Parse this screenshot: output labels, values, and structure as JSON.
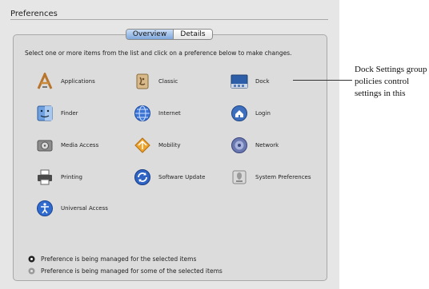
{
  "window": {
    "title": "Preferences"
  },
  "tabs": [
    {
      "label": "Overview",
      "active": true
    },
    {
      "label": "Details",
      "active": false
    }
  ],
  "instructions": "Select one or more items from the list and click on a preference below to make changes.",
  "items": [
    {
      "label": "Applications",
      "icon": "applications-icon"
    },
    {
      "label": "Classic",
      "icon": "classic-icon"
    },
    {
      "label": "Dock",
      "icon": "dock-icon"
    },
    {
      "label": "Finder",
      "icon": "finder-icon"
    },
    {
      "label": "Internet",
      "icon": "internet-icon"
    },
    {
      "label": "Login",
      "icon": "login-icon"
    },
    {
      "label": "Media Access",
      "icon": "media-access-icon"
    },
    {
      "label": "Mobility",
      "icon": "mobility-icon"
    },
    {
      "label": "Network",
      "icon": "network-icon"
    },
    {
      "label": "Printing",
      "icon": "printing-icon"
    },
    {
      "label": "Software Update",
      "icon": "software-update-icon"
    },
    {
      "label": "System Preferences",
      "icon": "system-preferences-icon"
    },
    {
      "label": "Universal Access",
      "icon": "universal-access-icon"
    }
  ],
  "legend": [
    {
      "text": "Preference is being managed for the selected items",
      "state": "full"
    },
    {
      "text": "Preference is being managed for some of the selected items",
      "state": "partial"
    }
  ],
  "callout": {
    "lines": [
      "Dock Settings group",
      "policies control",
      "settings in this"
    ]
  },
  "colors": {
    "accent": "#7fa8dc",
    "panel": "#dcdcdc",
    "window": "#e6e6e6"
  }
}
